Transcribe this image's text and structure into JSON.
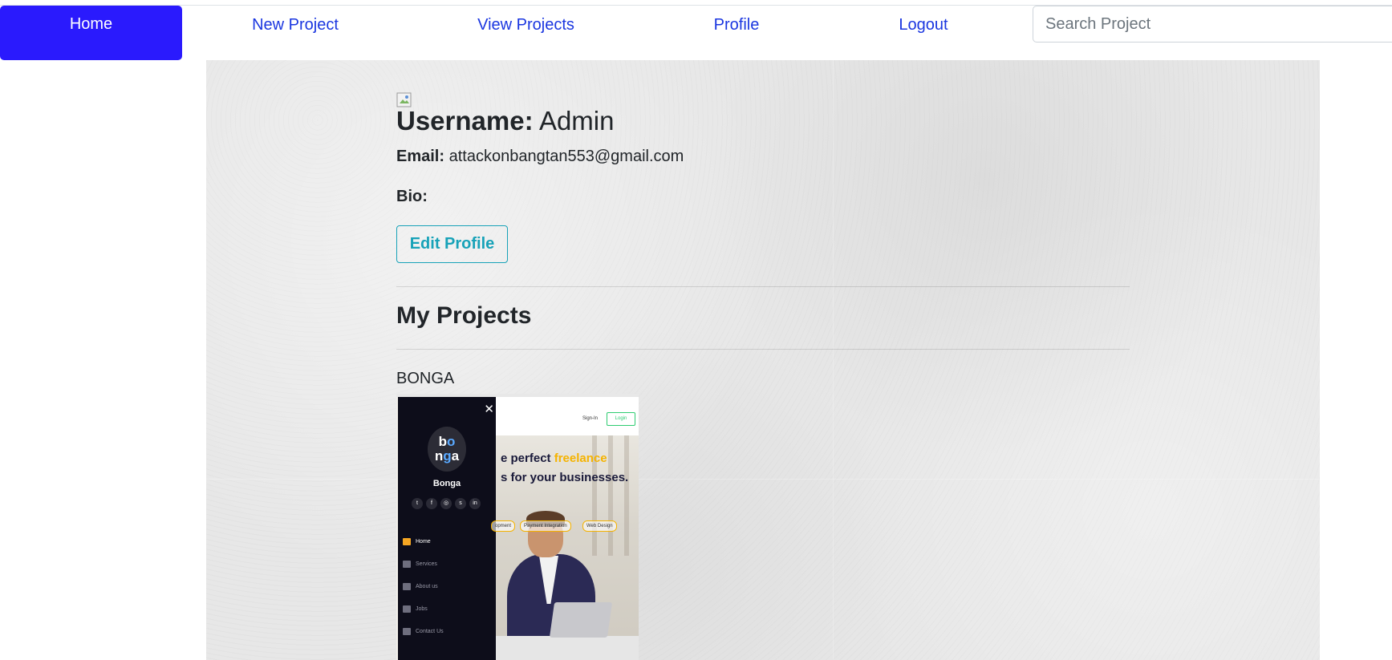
{
  "nav": {
    "home": "Home",
    "new_project": "New Project",
    "view_projects": "View Projects",
    "profile": "Profile",
    "logout": "Logout",
    "search_placeholder": "Search Project"
  },
  "profile": {
    "username_label": "Username:",
    "username_value": "Admin",
    "email_label": "Email:",
    "email_value": "attackonbangtan553@gmail.com",
    "bio_label": "Bio:",
    "edit_button": "Edit Profile"
  },
  "projects": {
    "heading": "My Projects",
    "items": [
      {
        "title": "BONGA",
        "thumbnail": {
          "brand": "Bonga",
          "logo_text": "bonga",
          "menu": [
            "Home",
            "Services",
            "About us",
            "Jobs",
            "Contact Us"
          ],
          "sign_in": "Sign-In",
          "login": "Login",
          "headline_part1": "e perfect",
          "headline_highlight": "freelance",
          "headline_line2": "s for your businesses.",
          "tags": [
            "opment",
            "Payment Integration",
            "Web Design"
          ],
          "social_icons": [
            "twitter-icon",
            "facebook-icon",
            "instagram-icon",
            "skype-icon",
            "linkedin-icon"
          ]
        }
      }
    ]
  },
  "colors": {
    "home_bg": "#2a1afd",
    "nav_link": "#1a36e0",
    "edit_button": "#17a2b8",
    "accent_yellow": "#f5b301"
  }
}
